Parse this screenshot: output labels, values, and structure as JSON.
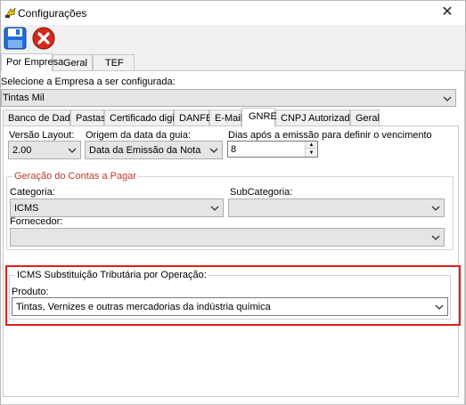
{
  "window": {
    "title": "Configurações"
  },
  "top_tabs": [
    "Por Empresa",
    "Geral",
    "TEF"
  ],
  "company": {
    "label": "Selecione a Empresa a ser configurada:",
    "value": "Tintas Mil"
  },
  "inner_tabs": [
    "Banco de Dados",
    "Pastas",
    "Certificado digital",
    "DANFE",
    "E-Mail",
    "GNRE",
    "CNPJ Autorizados",
    "Geral"
  ],
  "gnre": {
    "versao_label": "Versão Layout:",
    "versao_value": "2.00",
    "origem_label": "Origem da data da guia:",
    "origem_value": "Data da Emissão da Nota",
    "dias_label": "Dias após a emissão para definir o vencimento",
    "dias_value": "8",
    "contas_group": {
      "title": "Geração do Contas a Pagar",
      "title_color": "#c0392b",
      "categoria_label": "Categoria:",
      "categoria_value": "ICMS",
      "subcategoria_label": "SubCategoria:",
      "subcategoria_value": "",
      "fornecedor_label": "Fornecedor:",
      "fornecedor_value": ""
    },
    "icms_group": {
      "title": "ICMS Substituição Tributária por Operação:",
      "produto_label": "Produto:",
      "produto_value": "Tintas, Vernizes e outras mercadorias da indústria química"
    }
  },
  "colors": {
    "highlight": "#e0201a",
    "save_icon": "#1e6fd9",
    "cancel_icon": "#d42a1c"
  },
  "icons": {
    "save": "save-icon",
    "cancel": "cancel-icon",
    "app": "app-icon"
  }
}
